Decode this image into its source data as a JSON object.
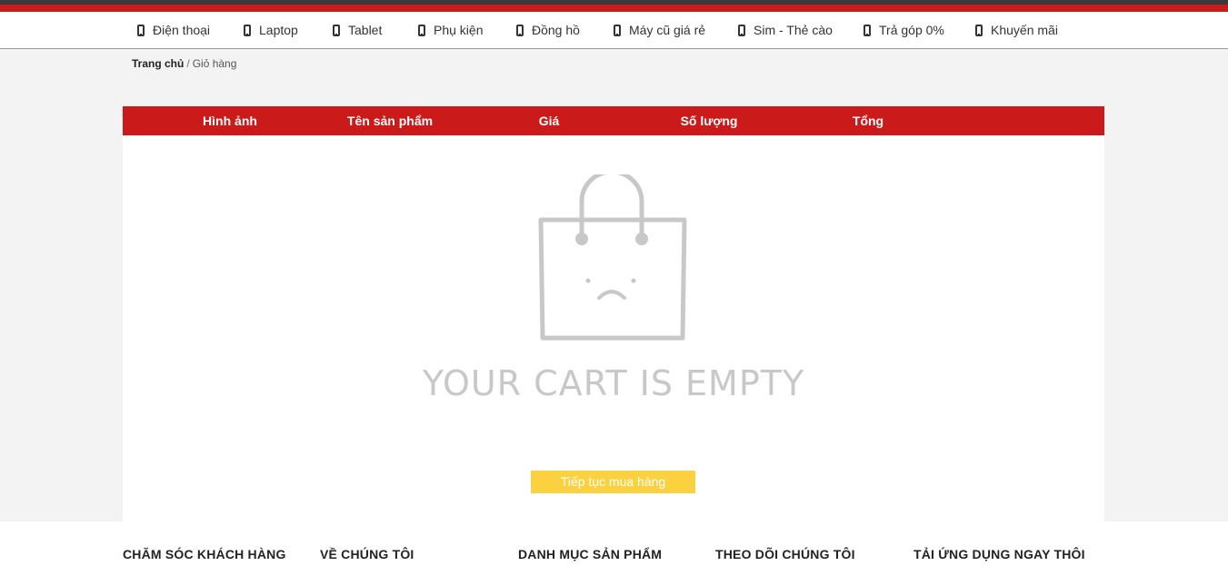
{
  "nav": {
    "items": [
      {
        "label": "Điện thoại",
        "icon": "phone-icon"
      },
      {
        "label": "Laptop",
        "icon": "phone-icon"
      },
      {
        "label": "Tablet",
        "icon": "phone-icon"
      },
      {
        "label": "Phụ kiện",
        "icon": "phone-icon"
      },
      {
        "label": "Đồng hồ",
        "icon": "phone-icon"
      },
      {
        "label": "Máy cũ giá rẻ",
        "icon": "phone-icon"
      },
      {
        "label": "Sim - Thẻ cào",
        "icon": "phone-icon"
      },
      {
        "label": "Trả góp 0%",
        "icon": "phone-icon"
      },
      {
        "label": "Khuyến mãi",
        "icon": "phone-icon"
      }
    ]
  },
  "breadcrumb": {
    "home": "Trang chủ",
    "separator": "/",
    "current": "Giỏ hàng"
  },
  "cart": {
    "columns": [
      "Hình ảnh",
      "Tên sản phẩm",
      "Giá",
      "Số lượng",
      "Tổng"
    ],
    "empty_message": "YOUR CART IS EMPTY",
    "continue_label": "Tiếp tục mua hàng",
    "empty_icon": "sad-shopping-bag-icon"
  },
  "footer": {
    "columns": [
      "CHĂM SÓC KHÁCH HÀNG",
      "VỀ CHÚNG TÔI",
      "DANH MỤC SẢN PHẨM",
      "THEO DÕI CHÚNG TÔI",
      "TẢI ỨNG DỤNG NGAY THÔI"
    ]
  },
  "colors": {
    "brand_red": "#cb1a1a",
    "button_yellow": "#fcd13f",
    "empty_gray": "#c8c8c8"
  }
}
